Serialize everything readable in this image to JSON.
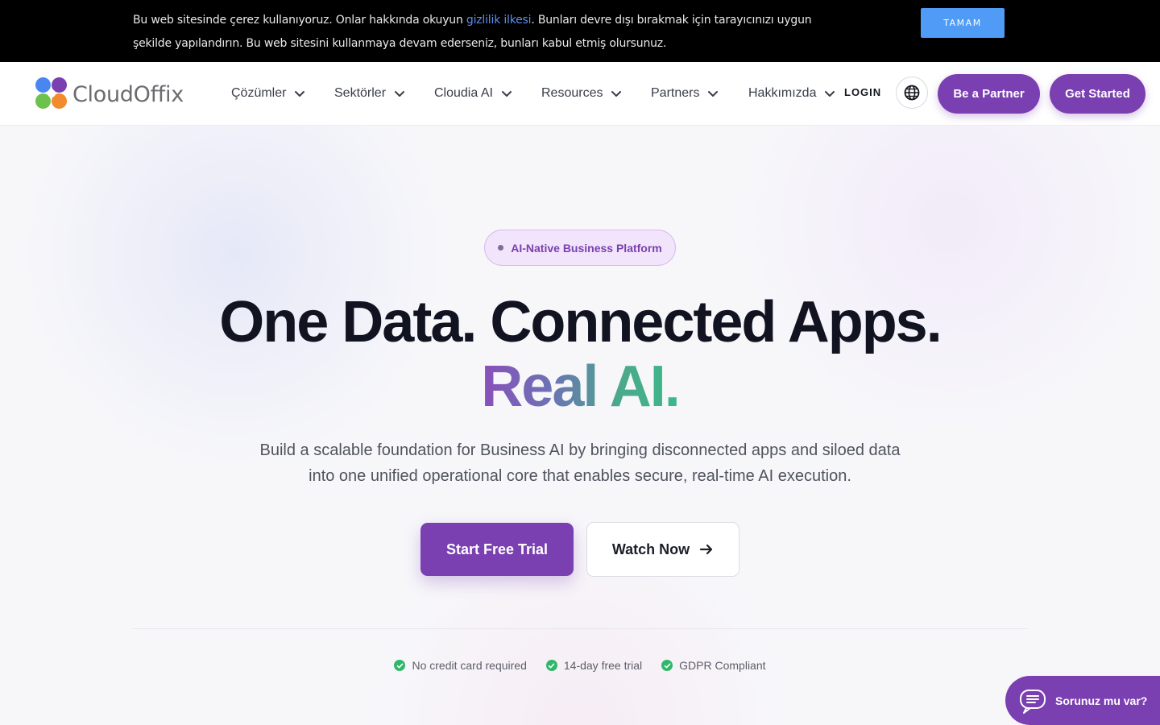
{
  "cookie_banner": {
    "text_before": "Bu web sitesinde çerez kullanıyoruz. Onlar hakkında okuyun ",
    "link_text": "gizlilik ilkesi",
    "text_after": ". Bunları devre dışı bırakmak için tarayıcınızı uygun şekilde yapılandırın. Bu web sitesini kullanmaya devam ederseniz, bunları kabul etmiş olursunuz.",
    "button_label": "TAMAM"
  },
  "header": {
    "logo_text": "CloudOffix",
    "nav_items": [
      {
        "label": "Çözümler"
      },
      {
        "label": "Sektörler"
      },
      {
        "label": "Cloudia AI"
      },
      {
        "label": "Resources"
      },
      {
        "label": "Partners"
      },
      {
        "label": "Hakkımızda"
      }
    ],
    "login_label": "LOGIN",
    "partner_label": "Be a Partner",
    "get_started_label": "Get Started"
  },
  "hero": {
    "badge": "AI-Native Business Platform",
    "title_line1": "One Data. Connected Apps.",
    "title_line2": "Real AI.",
    "subtitle": "Build a scalable foundation for Business AI by bringing disconnected apps and siloed data into one unified operational core that enables secure, real-time AI execution.",
    "primary_cta": "Start Free Trial",
    "secondary_cta": "Watch Now",
    "features": [
      "No credit card required",
      "14-day free trial",
      "GDPR Compliant"
    ]
  },
  "chat_widget": {
    "label": "Sorunuz mu var?"
  },
  "colors": {
    "brand_purple": "#7a3fb0",
    "accent_green": "#3cb88b",
    "cookie_button": "#4f9bf6"
  },
  "icons": {
    "nav_chevron": "chevron-down-icon",
    "language": "globe-icon",
    "cta_arrow": "arrow-right-icon",
    "feature": "check-circle-icon",
    "chat": "chat-bubble-icon"
  }
}
